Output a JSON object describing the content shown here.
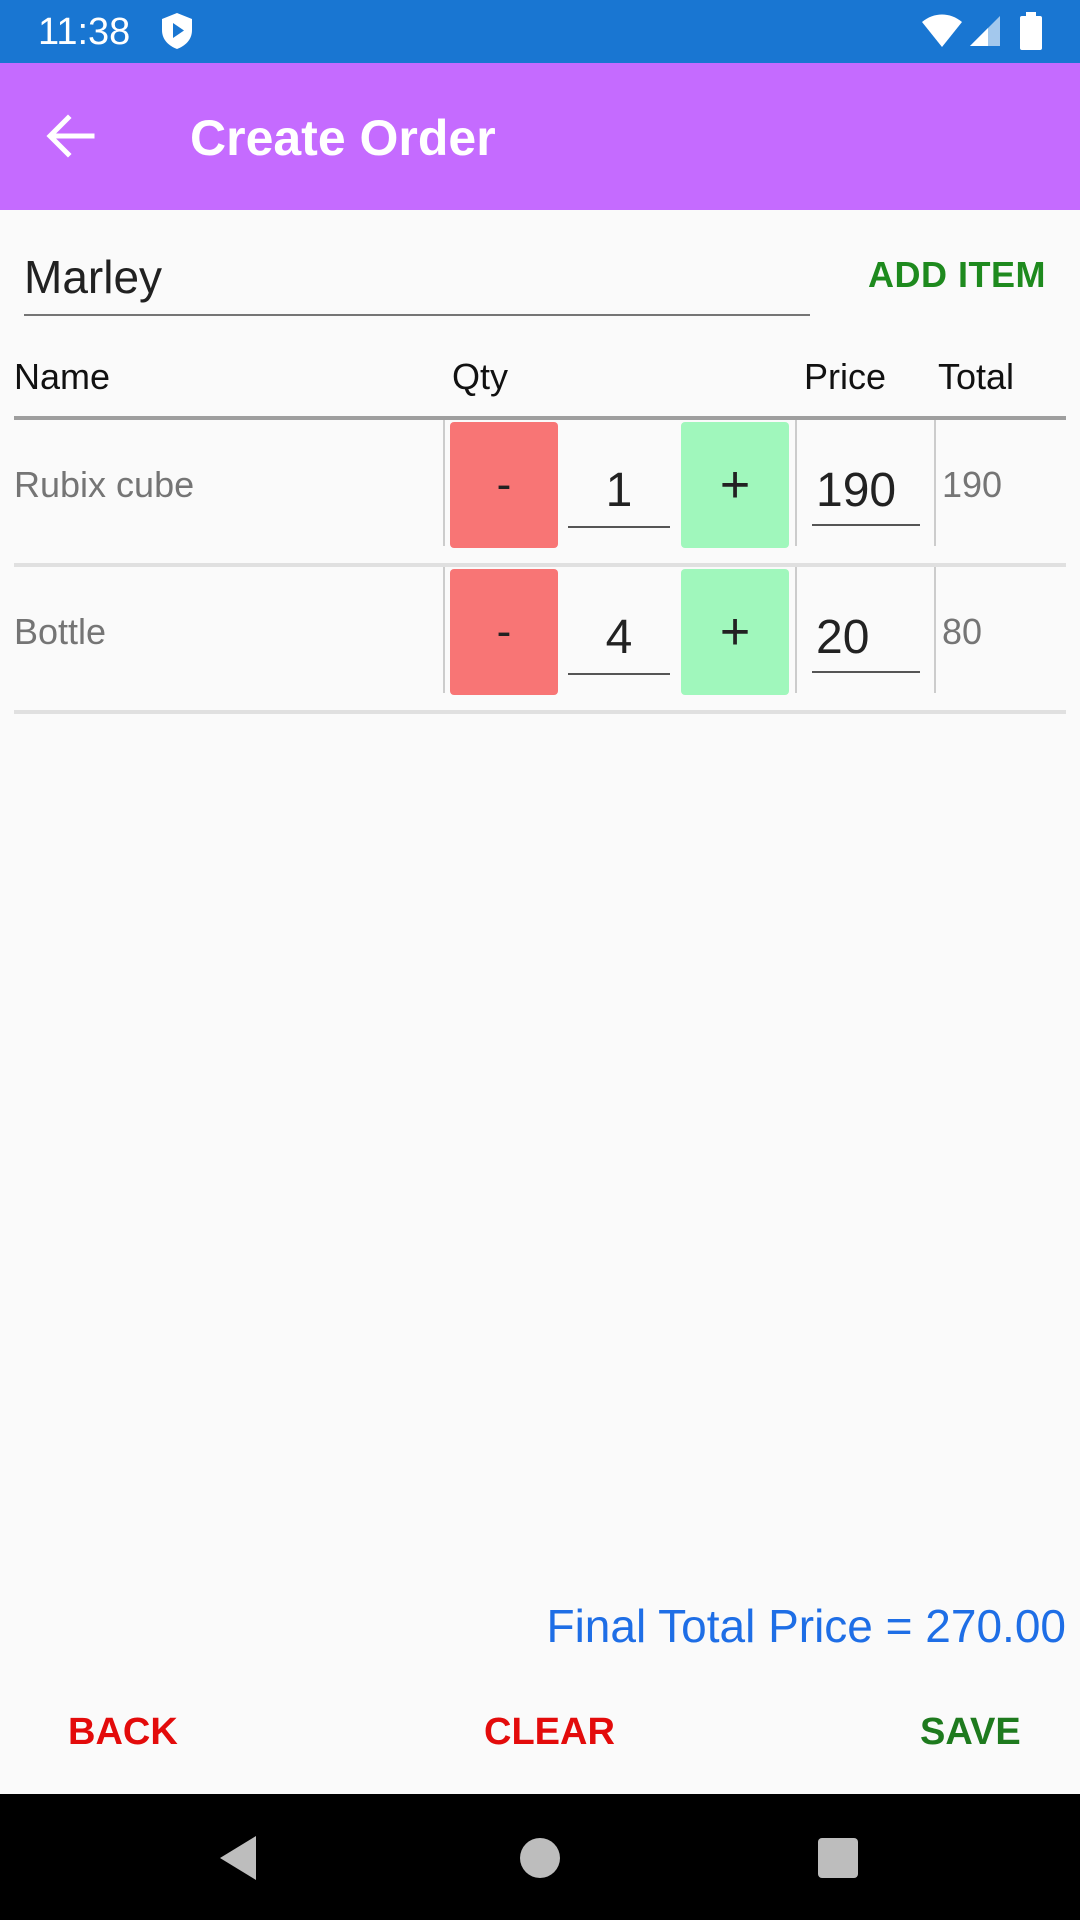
{
  "status_bar": {
    "time": "11:38",
    "color": "#1976d2"
  },
  "app_bar": {
    "title": "Create Order",
    "back_icon": "arrow-back-icon",
    "color": "#c56bff"
  },
  "customer": {
    "value": "Marley",
    "add_item_label": "ADD ITEM"
  },
  "table": {
    "headers": {
      "name": "Name",
      "qty": "Qty",
      "price": "Price",
      "total": "Total"
    },
    "rows": [
      {
        "name": "Rubix cube",
        "minus": "-",
        "qty": "1",
        "plus": "+",
        "price": "190",
        "total": "190"
      },
      {
        "name": "Bottle",
        "minus": "-",
        "qty": "4",
        "plus": "+",
        "price": "20",
        "total": "80"
      }
    ]
  },
  "footer": {
    "final_total": "Final Total Price = 270.00",
    "back_label": "BACK",
    "clear_label": "CLEAR",
    "save_label": "SAVE"
  },
  "colors": {
    "minus": "#f87575",
    "plus": "#a0f7bc",
    "total_text": "#1e6ee6",
    "danger": "#e30b0b",
    "success": "#1e7a1e"
  }
}
